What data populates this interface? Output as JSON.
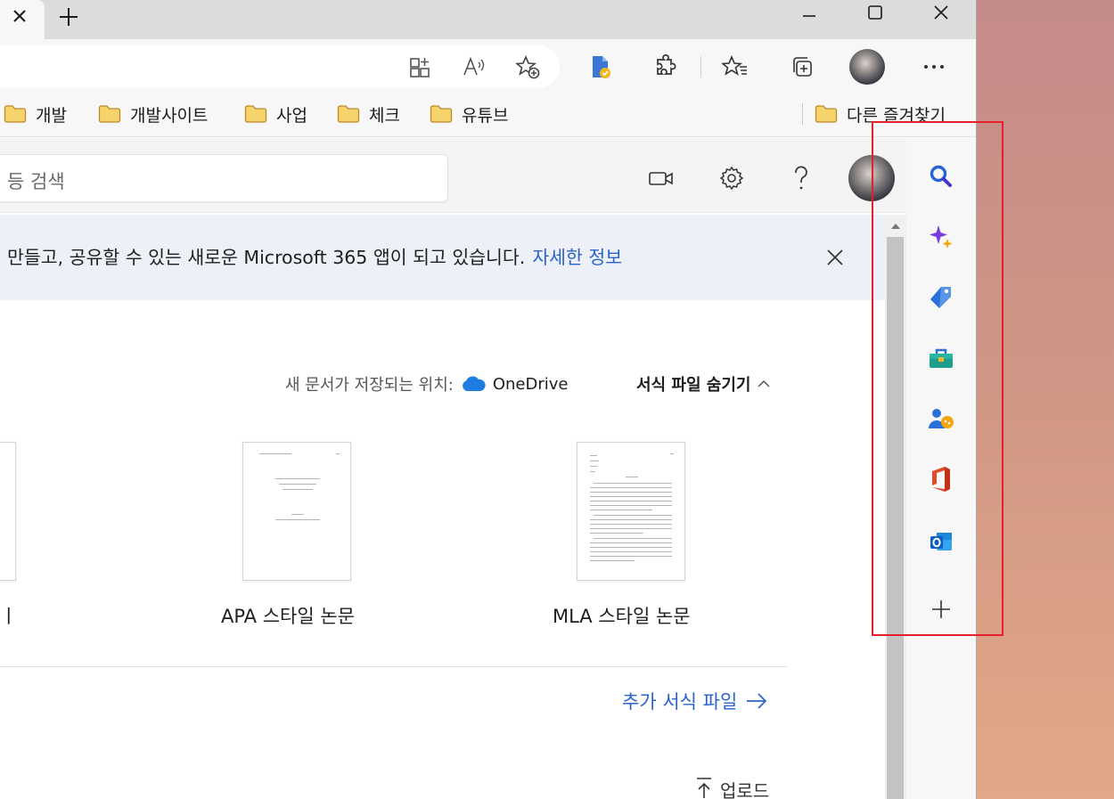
{
  "browser": {
    "tab_close_icon": "close-icon",
    "new_tab_icon": "plus-icon",
    "window_controls": [
      "minimize-icon",
      "maximize-icon",
      "close-icon"
    ],
    "favorites": [
      {
        "label": "개발",
        "icon": "folder-icon"
      },
      {
        "label": "개발사이트",
        "icon": "folder-icon"
      },
      {
        "label": "사업",
        "icon": "folder-icon"
      },
      {
        "label": "체크",
        "icon": "folder-icon"
      },
      {
        "label": "유튜브",
        "icon": "folder-icon"
      }
    ],
    "other_favorites": "다른 즐겨찾기"
  },
  "app": {
    "search_placeholder": "등 검색",
    "banner_text": "만들고, 공유할 수 있는 새로운 Microsoft 365 앱이 되고 있습니다.",
    "banner_link": "자세한 정보",
    "save_location_label": "새 문서가 저장되는 위치:",
    "save_location_value": "OneDrive",
    "hide_templates": "서식 파일 숨기기",
    "templates": [
      {
        "partial_label": "ㅣ"
      },
      {
        "label": "APA 스타일 논문"
      },
      {
        "label": "MLA 스타일 논문"
      }
    ],
    "more_templates": "추가 서식 파일",
    "upload": "업로드"
  },
  "sidebar": {
    "items": [
      "search-icon",
      "copilot-sparkle-icon",
      "shopping-tag-icon",
      "tools-toolbox-icon",
      "games-icon",
      "office-icon",
      "outlook-icon",
      "add-icon"
    ]
  },
  "colors": {
    "accent_link": "#2a63c9",
    "highlight_box": "#e5202b",
    "desktop_bg": "#c48b8b"
  }
}
